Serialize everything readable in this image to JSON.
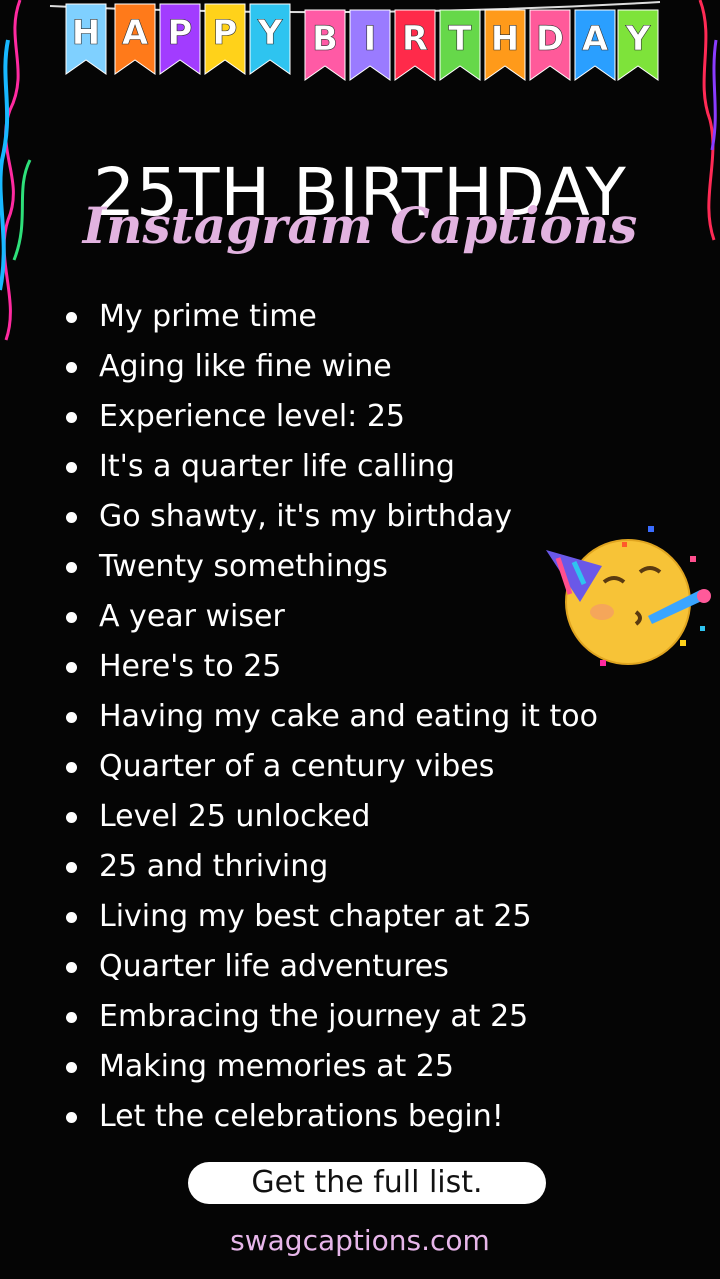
{
  "banner": {
    "letters": [
      "H",
      "A",
      "P",
      "P",
      "Y",
      "B",
      "I",
      "R",
      "T",
      "H",
      "D",
      "A",
      "Y"
    ],
    "flag_colors": [
      "#7fd0ff",
      "#ff7a1a",
      "#a23cff",
      "#ffd21a",
      "#2ec4f0",
      "#ff5aa5",
      "#9a7bff",
      "#ff2a4a",
      "#66d84a",
      "#ff9a1a",
      "#ff5a9a",
      "#2a9fff",
      "#7ee33a"
    ]
  },
  "title": "25TH BIRTHDAY",
  "subtitle": "Instagram Captions",
  "captions": [
    "My prime time",
    "Aging like fine wine",
    "Experience level: 25",
    "It's a quarter life calling",
    "Go shawty, it's my birthday",
    "Twenty somethings",
    "A year wiser",
    "Here's to 25",
    "Having my cake and eating it too",
    "Quarter of a century vibes",
    "Level 25 unlocked",
    "25 and thriving",
    "Living my best chapter at 25",
    "Quarter life adventures",
    "Embracing the journey at 25",
    "Making memories at 25",
    "Let the celebrations begin!"
  ],
  "cta_label": "Get the full list.",
  "website": "swagcaptions.com",
  "decorations": {
    "emoji": "partying-face-icon"
  }
}
